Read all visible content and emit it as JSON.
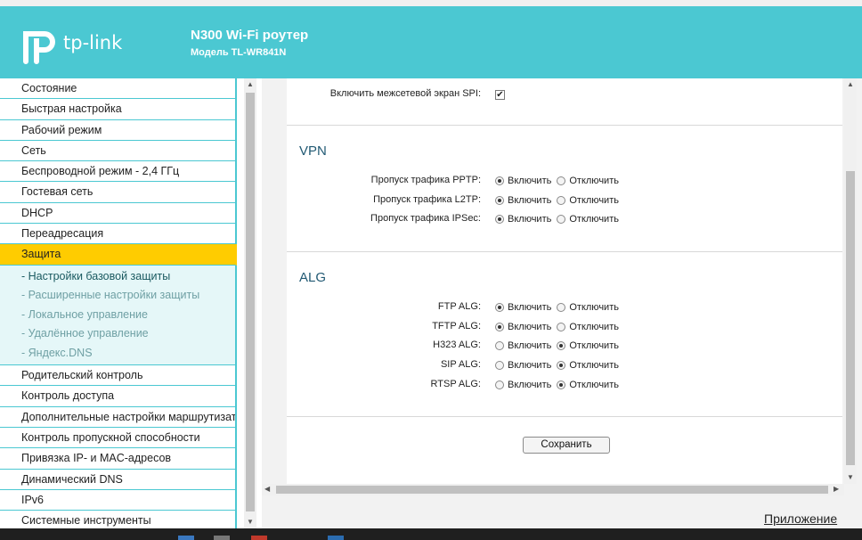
{
  "header": {
    "logo_text": "tp-link",
    "title": "N300 Wi-Fi роутер",
    "subtitle": "Модель TL-WR841N"
  },
  "sidebar": {
    "items_top": [
      {
        "label": "Состояние"
      },
      {
        "label": "Быстрая настройка"
      },
      {
        "label": "Рабочий режим"
      },
      {
        "label": "Сеть"
      },
      {
        "label": "Беспроводной режим - 2,4 ГГц"
      },
      {
        "label": "Гостевая сеть"
      },
      {
        "label": "DHCP"
      },
      {
        "label": "Переадресация"
      }
    ],
    "active": {
      "label": "Защита"
    },
    "sub_items": [
      {
        "label": "- Настройки базовой защиты"
      },
      {
        "label": "- Расширенные настройки защиты"
      },
      {
        "label": "- Локальное управление"
      },
      {
        "label": "- Удалённое управление"
      },
      {
        "label": "- Яндекс.DNS"
      }
    ],
    "items_bottom": [
      {
        "label": "Родительский контроль"
      },
      {
        "label": "Контроль доступа"
      },
      {
        "label": "Дополнительные настройки маршрутизатора"
      },
      {
        "label": "Контроль пропускной способности"
      },
      {
        "label": "Привязка IP- и MAC-адресов"
      },
      {
        "label": "Динамический DNS"
      },
      {
        "label": "IPv6"
      },
      {
        "label": "Системные инструменты"
      }
    ]
  },
  "form": {
    "spi_label": "Включить межсетевой экран SPI:",
    "spi_checked": true,
    "enable_label": "Включить",
    "disable_label": "Отключить",
    "vpn": {
      "title": "VPN",
      "rows": [
        {
          "label": "Пропуск трафика PPTP:",
          "enabled": true
        },
        {
          "label": "Пропуск трафика L2TP:",
          "enabled": true
        },
        {
          "label": "Пропуск трафика IPSec:",
          "enabled": true
        }
      ]
    },
    "alg": {
      "title": "ALG",
      "rows": [
        {
          "label": "FTP ALG:",
          "enabled": true
        },
        {
          "label": "TFTP ALG:",
          "enabled": true
        },
        {
          "label": "H323 ALG:",
          "enabled": false
        },
        {
          "label": "SIP ALG:",
          "enabled": false
        },
        {
          "label": "RTSP ALG:",
          "enabled": false
        }
      ]
    },
    "save_label": "Сохранить"
  },
  "footer": {
    "app_link": "Приложение"
  },
  "colors": {
    "header_bg": "#4bc8d2",
    "active_bg": "#ffcc00",
    "submenu_bg": "#e5f7f8"
  }
}
